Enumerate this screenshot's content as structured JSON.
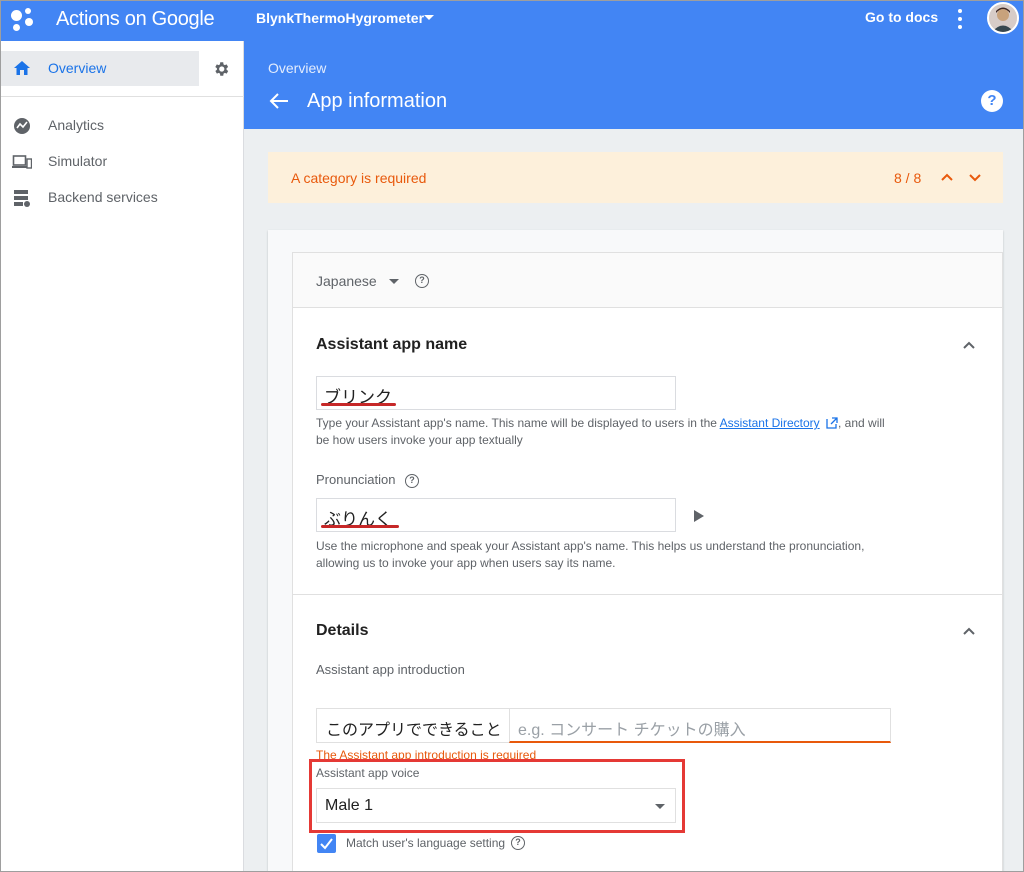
{
  "topbar": {
    "app_title": "Actions on Google",
    "project": "BlynkThermoHygrometer",
    "docs_link": "Go to docs",
    "brand_color": "#4285f4"
  },
  "sidebar": {
    "active": {
      "label": "Overview",
      "icon": "home-icon"
    },
    "settings_icon": "gear-icon",
    "items": [
      {
        "label": "Analytics",
        "icon": "analytics-icon"
      },
      {
        "label": "Simulator",
        "icon": "devices-icon"
      },
      {
        "label": "Backend services",
        "icon": "dns-icon"
      }
    ]
  },
  "header": {
    "breadcrumb": "Overview",
    "title": "App information",
    "help": "?"
  },
  "banner": {
    "message": "A category is required",
    "counter": "8 / 8",
    "color": "#e8590c"
  },
  "form": {
    "language": "Japanese",
    "app_name_section": {
      "title": "Assistant app name",
      "name_value": "ブリンク",
      "name_hint_before": "Type your Assistant app's name. This name will be displayed to users in the ",
      "name_hint_link": "Assistant Directory",
      "name_hint_after": ", and will be how users invoke your app textually",
      "pronunciation_label": "Pronunciation",
      "pronunciation_value": "ぶりんく",
      "pronunciation_hint": "Use the microphone and speak your Assistant app's name. This helps us understand the pronunciation, allowing us to invoke your app when users say its name."
    },
    "details_section": {
      "title": "Details",
      "intro_label": "Assistant app introduction",
      "intro_prefix": "このアプリでできること",
      "intro_placeholder": "e.g. コンサート チケットの購入",
      "intro_error": "The Assistant app introduction is required",
      "voice_label": "Assistant app voice",
      "voice_value": "Male 1",
      "match_language_label": "Match user's language setting",
      "match_language_checked": true
    }
  }
}
